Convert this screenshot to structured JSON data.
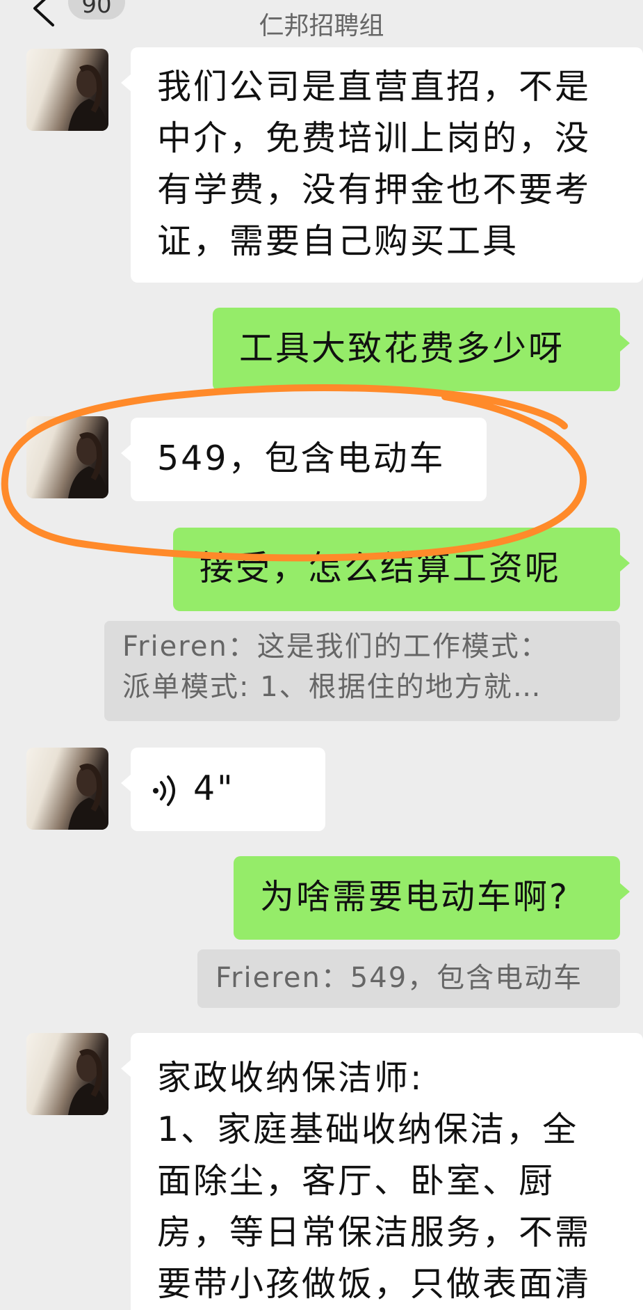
{
  "header": {
    "unread_count": "90",
    "title": "仁邦招聘组"
  },
  "messages": [
    {
      "direction": "in",
      "lines": [
        "我们公司是直营直招，不是",
        "中介，免费培训上岗的，没",
        "有学费，没有押金也不要考",
        "证，需要自己购买工具"
      ]
    },
    {
      "direction": "out",
      "text": "工具大致花费多少呀"
    },
    {
      "direction": "in",
      "text": "549，包含电动车"
    },
    {
      "direction": "out",
      "text": "接受，怎么结算工资呢",
      "quote_lines": [
        "Frieren：这是我们的工作模式：",
        "派单模式: 1、根据住的地方就…"
      ]
    },
    {
      "direction": "in",
      "type": "voice",
      "duration": "4\""
    },
    {
      "direction": "out",
      "text": "为啥需要电动车啊?",
      "quote_lines": [
        "Frieren：549，包含电动车"
      ]
    },
    {
      "direction": "in",
      "lines": [
        "家政收纳保洁师:",
        "1、家庭基础收纳保洁，全",
        "面除尘，客厅、卧室、厨",
        "房，等日常保洁服务，不需",
        "要带小孩做饭，只做表面清"
      ]
    }
  ],
  "annotation": {
    "color": "#ff8a2a"
  }
}
